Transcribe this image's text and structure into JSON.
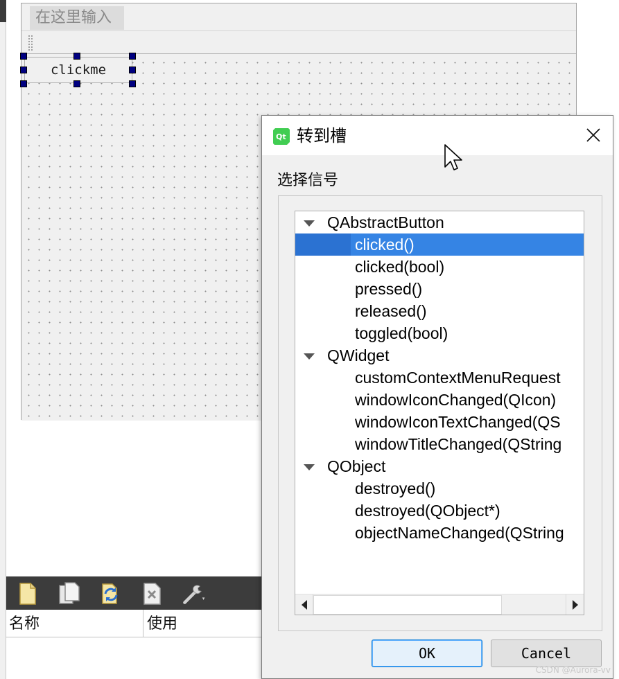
{
  "designer": {
    "menu_placeholder": "在这里输入",
    "button_text": "clickme"
  },
  "resource_browser": {
    "columns": [
      "名称",
      "使用"
    ],
    "icons": [
      "new-file-icon",
      "copy-file-icon",
      "reload-icon",
      "delete-file-icon",
      "tools-icon"
    ]
  },
  "dialog": {
    "title": "转到槽",
    "signal_label": "选择信号",
    "groups": [
      {
        "name": "QAbstractButton",
        "signals": [
          "clicked()",
          "clicked(bool)",
          "pressed()",
          "released()",
          "toggled(bool)"
        ]
      },
      {
        "name": "QWidget",
        "signals": [
          "customContextMenuRequest",
          "windowIconChanged(QIcon)",
          "windowIconTextChanged(QS",
          "windowTitleChanged(QString"
        ]
      },
      {
        "name": "QObject",
        "signals": [
          "destroyed()",
          "destroyed(QObject*)",
          "objectNameChanged(QString"
        ]
      }
    ],
    "selected_signal": "clicked()",
    "ok_label": "OK",
    "cancel_label": "Cancel"
  },
  "watermark": "CSDN @Aurora-vv",
  "colors": {
    "selection": "#3584e4",
    "handle": "#000080",
    "ok_border": "#0078d7"
  }
}
